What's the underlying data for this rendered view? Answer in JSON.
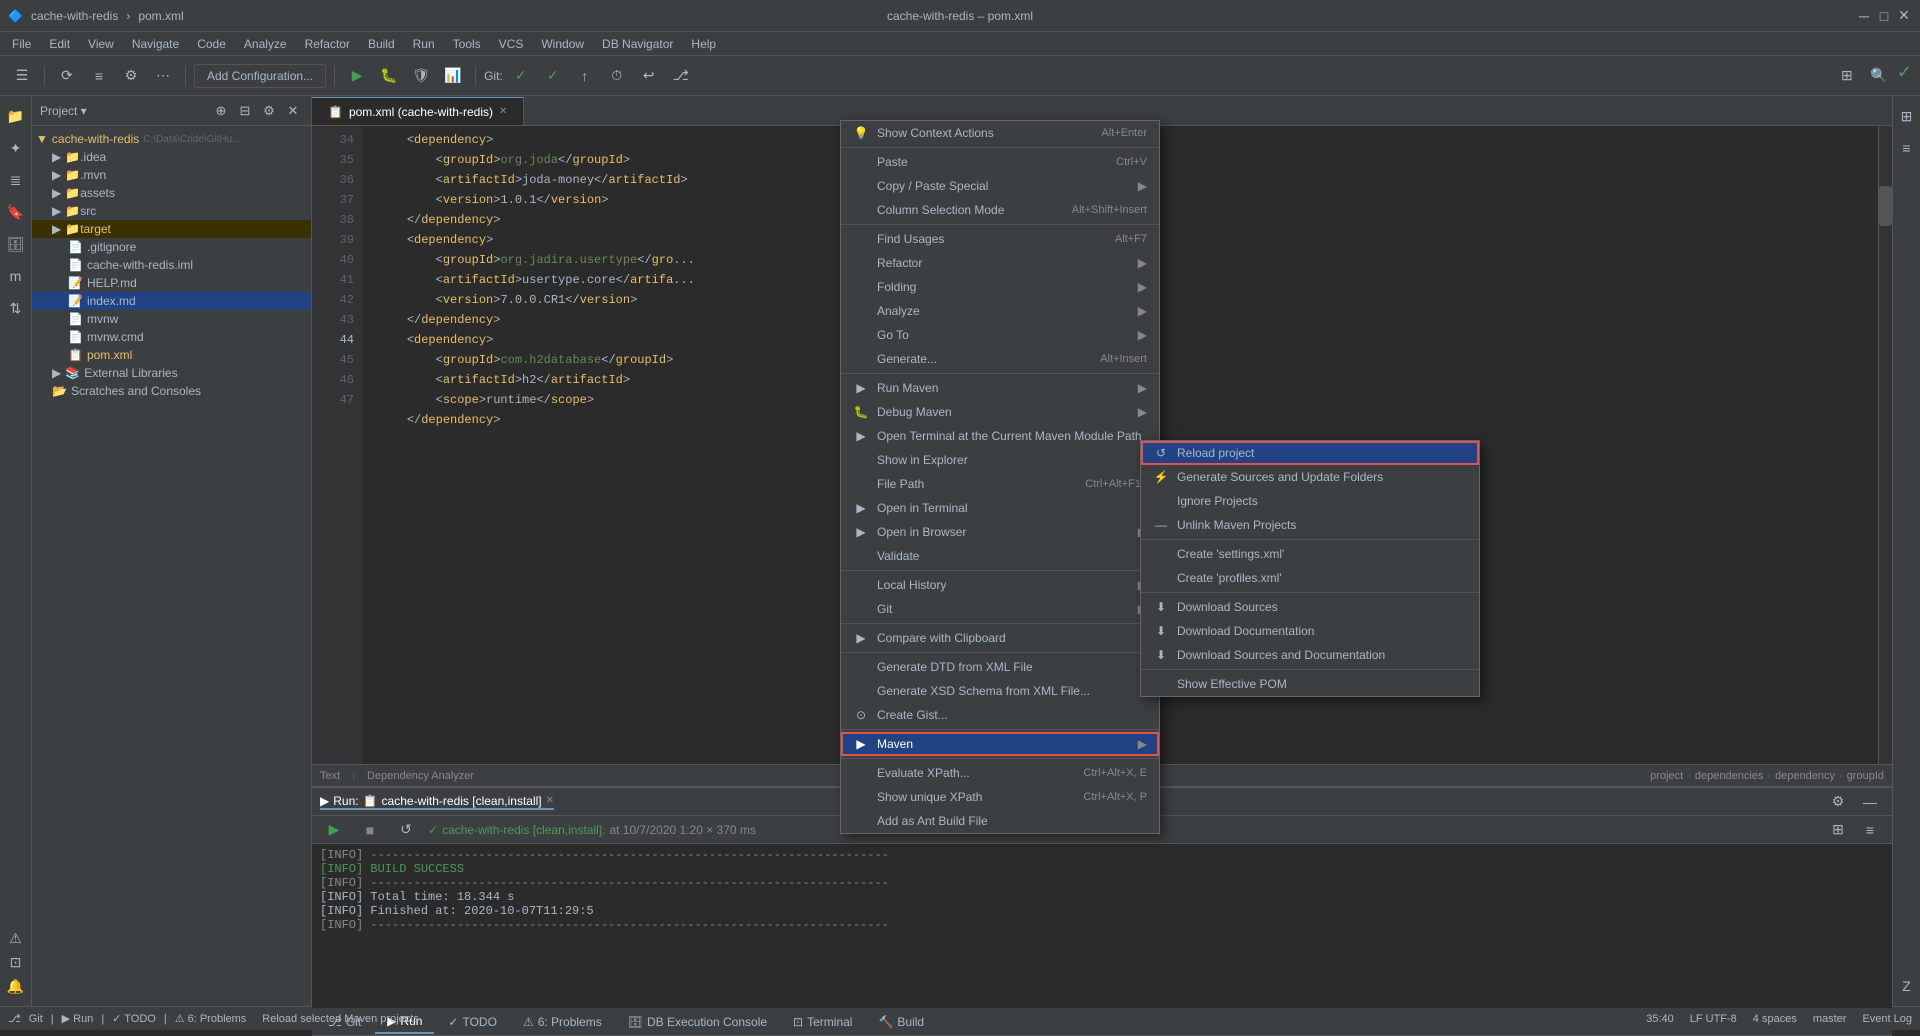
{
  "titlebar": {
    "project": "cache-with-redis",
    "file": "pom.xml",
    "title": "cache-with-redis – pom.xml",
    "minimize": "─",
    "maximize": "□",
    "close": "✕"
  },
  "menubar": {
    "items": [
      "File",
      "Edit",
      "View",
      "Navigate",
      "Code",
      "Analyze",
      "Refactor",
      "Build",
      "Run",
      "Tools",
      "VCS",
      "Window",
      "DB Navigator",
      "Help"
    ]
  },
  "toolbar": {
    "add_config": "Add Configuration...",
    "git_label": "Git:"
  },
  "project_panel": {
    "title": "Project",
    "root": "cache-with-redis",
    "root_path": "C:\\Data\\Code\\GitHu...",
    "items": [
      {
        "label": ".idea",
        "type": "folder",
        "indent": 1
      },
      {
        "label": ".mvn",
        "type": "folder",
        "indent": 1
      },
      {
        "label": "assets",
        "type": "folder",
        "indent": 1
      },
      {
        "label": "src",
        "type": "folder",
        "indent": 1
      },
      {
        "label": "target",
        "type": "folder",
        "indent": 1,
        "highlight": true
      },
      {
        "label": ".gitignore",
        "type": "file",
        "indent": 2
      },
      {
        "label": "cache-with-redis.iml",
        "type": "file",
        "indent": 2
      },
      {
        "label": "HELP.md",
        "type": "file",
        "indent": 2
      },
      {
        "label": "index.md",
        "type": "file",
        "indent": 2,
        "selected": true
      },
      {
        "label": "mvnw",
        "type": "file",
        "indent": 2
      },
      {
        "label": "mvnw.cmd",
        "type": "file",
        "indent": 2
      },
      {
        "label": "pom.xml",
        "type": "xml",
        "indent": 2
      }
    ],
    "external_libraries": "External Libraries",
    "scratches": "Scratches and Consoles"
  },
  "editor": {
    "tab": "pom.xml (cache-with-redis)",
    "lines": [
      {
        "num": 34,
        "content": "    <dependency>",
        "type": "tag"
      },
      {
        "num": 35,
        "content": "        <groupId>org.joda</groupId>",
        "type": "tag-val"
      },
      {
        "num": 36,
        "content": "        <artifactId>joda-money</artifactId>",
        "type": "tag"
      },
      {
        "num": 37,
        "content": "        <version>1.0.1</version>",
        "type": "tag"
      },
      {
        "num": 38,
        "content": "    </dependency>",
        "type": "tag"
      },
      {
        "num": 39,
        "content": "    <dependency>",
        "type": "tag"
      },
      {
        "num": 40,
        "content": "        <groupId>org.jadira.usertype</gro...",
        "type": "tag-val"
      },
      {
        "num": 41,
        "content": "        <artifactId>usertype.core</artifa...",
        "type": "tag"
      },
      {
        "num": 42,
        "content": "        <version>7.0.0.CR1</version>",
        "type": "tag"
      },
      {
        "num": 43,
        "content": "    </dependency>",
        "type": "tag"
      },
      {
        "num": 44,
        "content": "    <dependency>",
        "type": "tag"
      },
      {
        "num": 45,
        "content": "        <groupId>com.h2database</groupId>",
        "type": "tag-val"
      },
      {
        "num": 46,
        "content": "        <artifactId>h2</artifactId>",
        "type": "tag"
      },
      {
        "num": 47,
        "content": "        <scope>runtime</scope>",
        "type": "tag"
      }
    ],
    "breadcrumb": [
      "project",
      "dependencies",
      "dependency",
      "groupId"
    ]
  },
  "context_menu": {
    "items": [
      {
        "label": "Show Context Actions",
        "shortcut": "Alt+Enter",
        "icon": "💡"
      },
      {
        "label": "Paste",
        "shortcut": "Ctrl+V",
        "icon": "📋"
      },
      {
        "label": "Copy / Paste Special",
        "arrow": true
      },
      {
        "label": "Column Selection Mode",
        "shortcut": "Alt+Shift+Insert"
      },
      {
        "label": "Find Usages",
        "shortcut": "Alt+F7"
      },
      {
        "label": "Refactor",
        "arrow": true
      },
      {
        "label": "Folding",
        "arrow": true
      },
      {
        "label": "Analyze",
        "arrow": true
      },
      {
        "label": "Go To",
        "arrow": true
      },
      {
        "label": "Generate...",
        "shortcut": "Alt+Insert"
      },
      {
        "label": "Run Maven",
        "icon": "▶",
        "arrow": true
      },
      {
        "label": "Debug Maven",
        "icon": "🐛",
        "arrow": true
      },
      {
        "label": "Open Terminal at the Current Maven Module Path",
        "arrow": true
      },
      {
        "label": "Show in Explorer"
      },
      {
        "label": "File Path",
        "shortcut": "Ctrl+Alt+F12"
      },
      {
        "label": "Open in Terminal"
      },
      {
        "label": "Open in Browser",
        "arrow": true
      },
      {
        "label": "Validate"
      },
      {
        "label": "Local History",
        "arrow": true
      },
      {
        "label": "Git",
        "arrow": true
      },
      {
        "label": "Compare with Clipboard"
      },
      {
        "label": "Generate DTD from XML File"
      },
      {
        "label": "Generate XSD Schema from XML File..."
      },
      {
        "label": "Create Gist..."
      },
      {
        "label": "Maven",
        "highlighted": true,
        "arrow": true
      },
      {
        "label": "Evaluate XPath...",
        "shortcut": "Ctrl+Alt+X, E"
      },
      {
        "label": "Show unique XPath",
        "shortcut": "Ctrl+Alt+X, P"
      },
      {
        "label": "Add as Ant Build File"
      }
    ]
  },
  "maven_submenu": {
    "items": [
      {
        "label": "Reload project",
        "highlighted": true,
        "red_border": true
      },
      {
        "label": "Generate Sources and Update Folders",
        "icon": "⚡"
      },
      {
        "label": "Ignore Projects",
        "disabled": false
      },
      {
        "label": "Unlink Maven Projects",
        "minus": true
      },
      {
        "label": "Create 'settings.xml'"
      },
      {
        "label": "Create 'profiles.xml'"
      },
      {
        "separator": true
      },
      {
        "label": "Download Sources",
        "icon": "⬇"
      },
      {
        "label": "Download Documentation",
        "icon": "⬇"
      },
      {
        "label": "Download Sources and Documentation",
        "icon": "⬇"
      },
      {
        "label": "Show Effective POM"
      }
    ]
  },
  "run_panel": {
    "tab": "cache-with-redis [clean,install]",
    "header": "cache-with-redis [clean,install]:",
    "timestamp": "at 10/7/2020 1:20 × 370 ms",
    "lines": [
      "[INFO] --------------------------------",
      "[INFO] BUILD SUCCESS",
      "[INFO] --------------------------------",
      "[INFO] Total time:  18.344 s",
      "[INFO] Finished at: 2020-10-07T11:29:5",
      "[INFO] --------------------------------"
    ]
  },
  "bottom_tabs": [
    "Run: cache-with-redis [clean,install]",
    "TODO",
    "6: Problems",
    "DB Execution Console",
    "Terminal",
    "Build"
  ],
  "status_bar": {
    "git": "Git",
    "run": "Run",
    "todo": "TODO",
    "problems": "6: Problems",
    "position": "35:40",
    "encoding": "LF  UTF-8",
    "spaces": "4 spaces",
    "branch": "master",
    "message": "Reload selected Maven projects",
    "event_log": "Event Log"
  }
}
